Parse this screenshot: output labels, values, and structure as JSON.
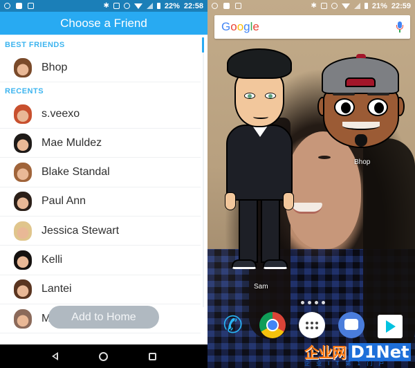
{
  "left_screen": {
    "status_bar": {
      "left_icons": [
        "alarm-icon",
        "image-icon",
        "photo-stack-icon"
      ],
      "right_icons": [
        "bluetooth-icon",
        "vibrate-icon",
        "alarm-icon",
        "wifi-icon",
        "cell-signal-icon",
        "battery-icon"
      ],
      "battery": "22%",
      "time": "22:58"
    },
    "header": {
      "title": "Choose a Friend"
    },
    "sections": [
      {
        "label": "BEST FRIENDS",
        "friends": [
          {
            "name": "Bhop",
            "avatar_color": "#7a4a2a"
          }
        ]
      },
      {
        "label": "RECENTS",
        "friends": [
          {
            "name": "s.veexo",
            "avatar_color": "#c8502e"
          },
          {
            "name": "Mae Muldez",
            "avatar_color": "#1e1a18"
          },
          {
            "name": "Blake Standal",
            "avatar_color": "#a0643a"
          },
          {
            "name": "Paul Ann",
            "avatar_color": "#2b1f18"
          },
          {
            "name": "Jessica Stewart",
            "avatar_color": "#e0c58c"
          },
          {
            "name": "Kelli",
            "avatar_color": "#15110f"
          },
          {
            "name": "Lantei",
            "avatar_color": "#5a3520"
          },
          {
            "name": "M",
            "avatar_color": "#8b6a5a"
          }
        ]
      }
    ],
    "add_to_home_button": "Add to Home",
    "nav_bar": [
      "back-icon",
      "home-icon",
      "recents-icon"
    ]
  },
  "right_screen": {
    "status_bar": {
      "left_icons": [
        "alarm-icon",
        "image-icon",
        "photo-stack-icon"
      ],
      "right_icons": [
        "bluetooth-icon",
        "vibrate-icon",
        "alarm-icon",
        "wifi-icon",
        "cell-signal-icon",
        "battery-icon"
      ],
      "battery": "21%",
      "time": "22:59"
    },
    "search_bar": {
      "logo_letters": [
        {
          "ch": "G",
          "color": "#4285f4"
        },
        {
          "ch": "o",
          "color": "#ea4335"
        },
        {
          "ch": "o",
          "color": "#fbbc05"
        },
        {
          "ch": "g",
          "color": "#4285f4"
        },
        {
          "ch": "l",
          "color": "#34a853"
        },
        {
          "ch": "e",
          "color": "#ea4335"
        }
      ],
      "mic_icon": "mic-icon"
    },
    "home_widgets": [
      {
        "label": "Sam",
        "type": "bitmoji-full-body"
      },
      {
        "label": "Bhop",
        "type": "bitmoji-head"
      }
    ],
    "page_indicator_count": 4,
    "dock_apps": [
      "Phone",
      "Chrome",
      "App Drawer",
      "Messages",
      "Play Store"
    ],
    "nav_bar": [
      "back-icon",
      "home-icon",
      "recents-icon"
    ]
  },
  "watermark": {
    "chinese": "企业网",
    "brand": "D1Net",
    "subtitle": "企业IT第1门户"
  },
  "colors": {
    "header_blue": "#28aaf2",
    "status_blue": "#1b7fb8",
    "section_label": "#3cb4ef",
    "add_home_bg": "#b0b9c1"
  }
}
